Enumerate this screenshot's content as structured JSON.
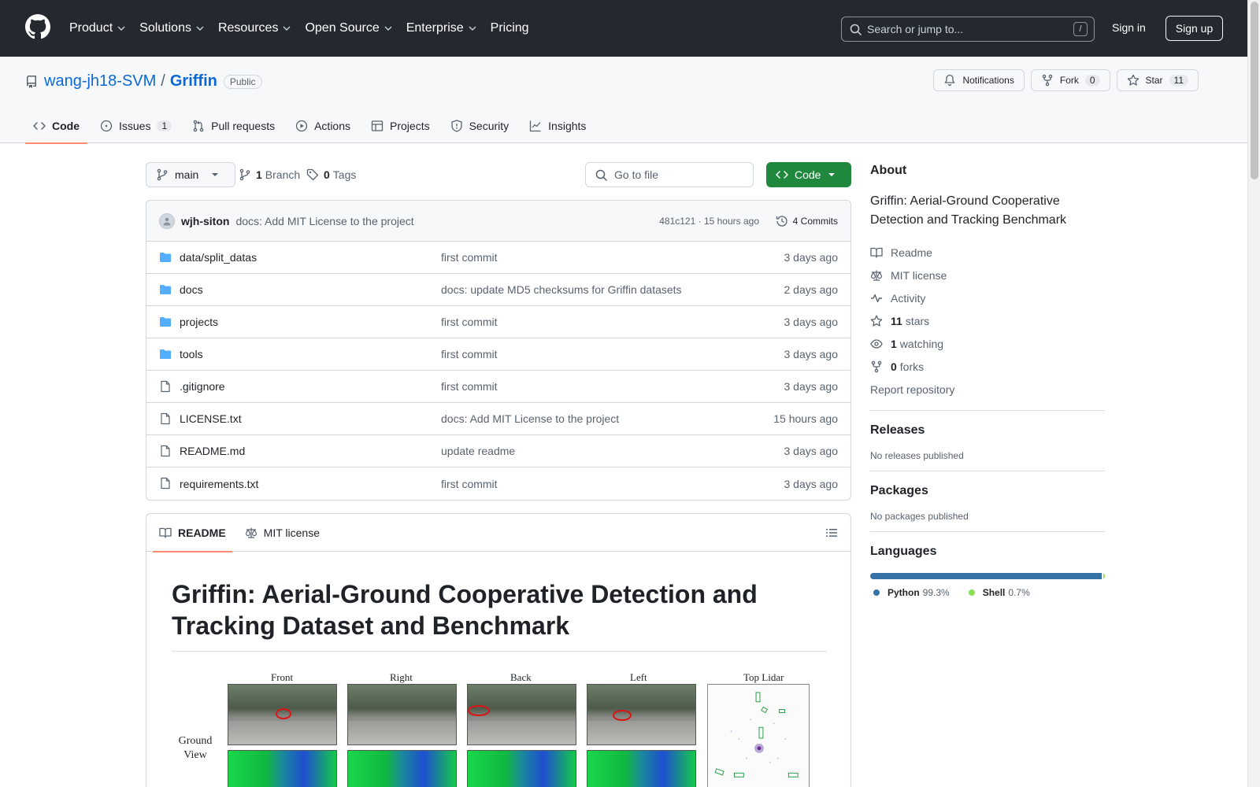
{
  "nav": {
    "items": [
      {
        "label": "Product",
        "dropdown": true
      },
      {
        "label": "Solutions",
        "dropdown": true
      },
      {
        "label": "Resources",
        "dropdown": true
      },
      {
        "label": "Open Source",
        "dropdown": true
      },
      {
        "label": "Enterprise",
        "dropdown": true
      },
      {
        "label": "Pricing",
        "dropdown": false
      }
    ],
    "search_placeholder": "Search or jump to...",
    "search_shortcut": "/",
    "signin": "Sign in",
    "signup": "Sign up"
  },
  "repo": {
    "owner": "wang-jh18-SVM",
    "separator": "/",
    "name": "Griffin",
    "visibility": "Public",
    "notifications_label": "Notifications",
    "fork_label": "Fork",
    "fork_count": "0",
    "star_label": "Star",
    "star_count": "11",
    "tabs": [
      {
        "label": "Code",
        "icon": "code-icon",
        "selected": true
      },
      {
        "label": "Issues",
        "icon": "issue-icon",
        "count": "1"
      },
      {
        "label": "Pull requests",
        "icon": "pull-request-icon"
      },
      {
        "label": "Actions",
        "icon": "play-icon"
      },
      {
        "label": "Projects",
        "icon": "table-icon"
      },
      {
        "label": "Security",
        "icon": "shield-icon"
      },
      {
        "label": "Insights",
        "icon": "graph-icon"
      }
    ]
  },
  "toolbar": {
    "branch": "main",
    "branch_count": "1",
    "branch_label": "Branch",
    "tag_count": "0",
    "tag_label": "Tags",
    "goto_placeholder": "Go to file",
    "code_button": "Code"
  },
  "commit": {
    "author": "wjh-siton",
    "message": "docs: Add MIT License to the project",
    "hash_time": "481c121 · 15 hours ago",
    "commits": "4 Commits"
  },
  "files": [
    {
      "type": "dir",
      "name": "data/split_datas",
      "message": "first commit",
      "date": "3 days ago"
    },
    {
      "type": "dir",
      "name": "docs",
      "message": "docs: update MD5 checksums for Griffin datasets",
      "date": "2 days ago"
    },
    {
      "type": "dir",
      "name": "projects",
      "message": "first commit",
      "date": "3 days ago"
    },
    {
      "type": "dir",
      "name": "tools",
      "message": "first commit",
      "date": "3 days ago"
    },
    {
      "type": "file",
      "name": ".gitignore",
      "message": "first commit",
      "date": "3 days ago"
    },
    {
      "type": "file",
      "name": "LICENSE.txt",
      "message": "docs: Add MIT License to the project",
      "date": "15 hours ago"
    },
    {
      "type": "file",
      "name": "README.md",
      "message": "update readme",
      "date": "3 days ago"
    },
    {
      "type": "file",
      "name": "requirements.txt",
      "message": "first commit",
      "date": "3 days ago"
    }
  ],
  "readme": {
    "tab_readme": "README",
    "tab_license": "MIT license",
    "title": "Griffin: Aerial-Ground Cooperative Detection and Tracking Dataset and Benchmark",
    "figure": {
      "columns": [
        "Front",
        "Right",
        "Back",
        "Left",
        "Top Lidar"
      ],
      "row_label": "Ground View"
    }
  },
  "about": {
    "heading": "About",
    "description": "Griffin: Aerial-Ground Cooperative Detection and Tracking Benchmark",
    "items": [
      {
        "icon": "book-icon",
        "bold": "",
        "text": "Readme"
      },
      {
        "icon": "law-icon",
        "bold": "",
        "text": "MIT license"
      },
      {
        "icon": "pulse-icon",
        "bold": "",
        "text": "Activity"
      },
      {
        "icon": "star-icon",
        "bold": "11",
        "text": "stars"
      },
      {
        "icon": "eye-icon",
        "bold": "1",
        "text": "watching"
      },
      {
        "icon": "fork-icon",
        "bold": "0",
        "text": "forks"
      }
    ],
    "report": "Report repository"
  },
  "releases": {
    "heading": "Releases",
    "text": "No releases published"
  },
  "packages": {
    "heading": "Packages",
    "text": "No packages published"
  },
  "languages": {
    "heading": "Languages",
    "list": [
      {
        "name": "Python",
        "percent": "99.3%",
        "value": 99.3,
        "color": "#3572A5"
      },
      {
        "name": "Shell",
        "percent": "0.7%",
        "value": 0.7,
        "color": "#89e051"
      }
    ]
  }
}
